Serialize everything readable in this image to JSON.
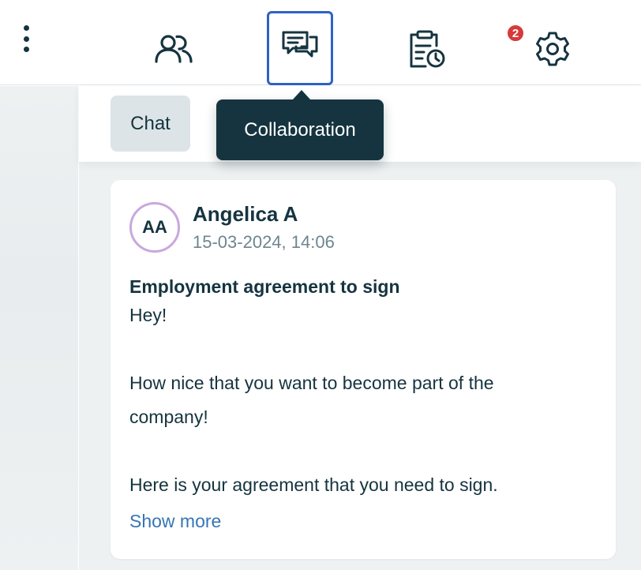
{
  "menu": {
    "icon": "kebab-menu-icon"
  },
  "nav": {
    "items": [
      {
        "name": "users",
        "icon": "users-icon"
      },
      {
        "name": "collaboration",
        "icon": "chat-bubbles-icon",
        "active": true
      },
      {
        "name": "tasks",
        "icon": "clipboard-clock-icon",
        "badge": "2"
      },
      {
        "name": "settings",
        "icon": "gear-icon"
      }
    ],
    "badge_color": "#d63a3a",
    "active_border_color": "#2e62c8"
  },
  "tabs": {
    "chat_label": "Chat"
  },
  "tooltip": {
    "text": "Collaboration"
  },
  "message": {
    "avatar_initials": "AA",
    "avatar_ring_color": "#c9a8dd",
    "author": "Angelica A",
    "timestamp": "15-03-2024, 14:06",
    "subject": "Employment agreement to sign",
    "lines": [
      "Hey!",
      "",
      "How nice that you want to become part of the",
      "company!",
      "",
      "Here is your agreement that you need to sign."
    ],
    "show_more_label": "Show more",
    "link_color": "#3575b4"
  },
  "colors": {
    "primary_text": "#15343f",
    "muted_text": "#6e8590",
    "tooltip_bg": "#15343f",
    "background": "#eef1f2"
  }
}
